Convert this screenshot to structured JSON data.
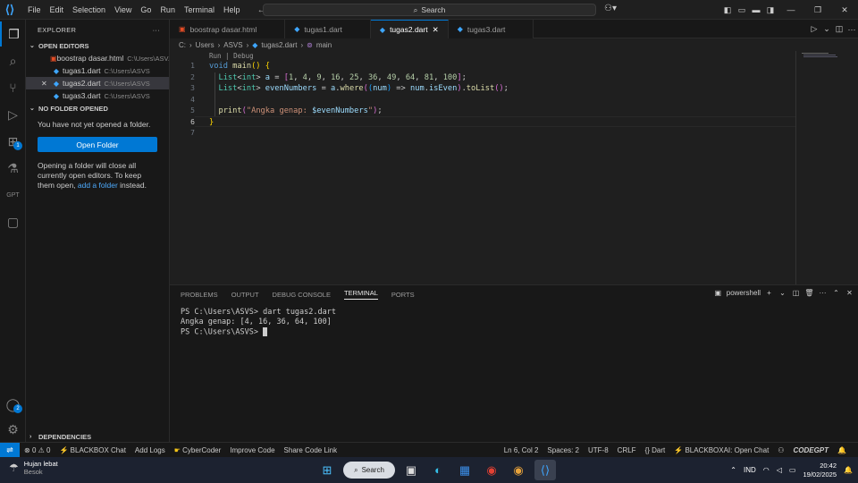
{
  "menu": [
    "File",
    "Edit",
    "Selection",
    "View",
    "Go",
    "Run",
    "Terminal",
    "Help"
  ],
  "command_center": {
    "label": "Search"
  },
  "explorer": {
    "title": "EXPLORER",
    "open_editors_label": "OPEN EDITORS",
    "open_editors": [
      {
        "name": "boostrap dasar.html",
        "path": "C:\\Users\\ASV..."
      },
      {
        "name": "tugas1.dart",
        "path": "C:\\Users\\ASVS"
      },
      {
        "name": "tugas2.dart",
        "path": "C:\\Users\\ASVS"
      },
      {
        "name": "tugas3.dart",
        "path": "C:\\Users\\ASVS"
      }
    ],
    "no_folder_label": "NO FOLDER OPENED",
    "no_folder_text": "You have not yet opened a folder.",
    "open_folder_button": "Open Folder",
    "warning_prefix": "Opening a folder will close all currently open editors. To keep them open, ",
    "warning_link": "add a folder",
    "warning_suffix": " instead.",
    "dependencies_label": "DEPENDENCIES"
  },
  "tabs": [
    {
      "label": "boostrap dasar.html"
    },
    {
      "label": "tugas1.dart"
    },
    {
      "label": "tugas2.dart"
    },
    {
      "label": "tugas3.dart"
    }
  ],
  "breadcrumb": [
    "C:",
    "Users",
    "ASVS",
    "tugas2.dart",
    "main"
  ],
  "editor": {
    "codelens": "Run | Debug",
    "line_numbers": [
      "1",
      "2",
      "3",
      "4",
      "5",
      "6",
      "7"
    ]
  },
  "panel": {
    "tabs": [
      "PROBLEMS",
      "OUTPUT",
      "DEBUG CONSOLE",
      "TERMINAL",
      "PORTS"
    ],
    "shell": "powershell",
    "terminal_lines": [
      "PS C:\\Users\\ASVS> dart tugas2.dart",
      "Angka genap: [4, 16, 36, 64, 100]",
      "PS C:\\Users\\ASVS> "
    ]
  },
  "status": {
    "errors": "0",
    "warnings": "0",
    "left_items": [
      "BLACKBOX Chat",
      "Add Logs",
      "CyberCoder",
      "Improve Code",
      "Share Code Link"
    ],
    "position": "Ln 6, Col 2",
    "spaces": "Spaces: 2",
    "encoding": "UTF-8",
    "eol": "CRLF",
    "language": "Dart",
    "blackbox_ai": "BLACKBOXAI: Open Chat",
    "codegpt": "CODEGPT"
  },
  "taskbar": {
    "weather_title": "Hujan lebat",
    "weather_sub": "Besok",
    "search_label": "Search",
    "lang": "IND",
    "time": "20:42",
    "date": "19/02/2025"
  },
  "accounts_badge": "2",
  "extensions_badge": "1"
}
